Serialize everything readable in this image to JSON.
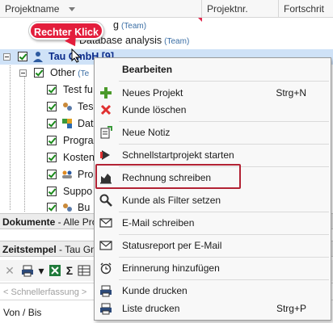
{
  "grid": {
    "columns": [
      "Projektname",
      "Projektnr.",
      "Fortschrit"
    ]
  },
  "tree": {
    "rows": [
      {
        "label": "g",
        "team": "(Team)"
      },
      {
        "label": "Database analysis",
        "team": "(Team)"
      },
      {
        "label": "Tau GmbH [9]",
        "team": ""
      },
      {
        "label": "Other",
        "team": "(Te"
      },
      {
        "label": "Test fu",
        "team": ""
      },
      {
        "label": "Tes",
        "team": ""
      },
      {
        "label": "Dat",
        "team": ""
      },
      {
        "label": "Progra",
        "team": ""
      },
      {
        "label": "Kosten",
        "team": ""
      },
      {
        "label": "Pro",
        "team": ""
      },
      {
        "label": "Suppo",
        "team": ""
      },
      {
        "label": "Bu",
        "team": ""
      }
    ]
  },
  "callout": {
    "text": "Rechter Klick",
    "color": "#e31e3c"
  },
  "panels": {
    "documents": {
      "title": "Dokumente",
      "rest": " - Alle Pro"
    },
    "timestamps": {
      "title": "Zeitstempel",
      "rest": " - Tau Gm"
    },
    "quick_entry_placeholder": "< Schnellerfassung >",
    "von_bis": "Von / Bis"
  },
  "context_menu": {
    "items": [
      {
        "label": "Bearbeiten",
        "shortcut": "",
        "icon": "no-icon"
      },
      {
        "label": "Neues Projekt",
        "shortcut": "Strg+N",
        "icon": "plus-icon"
      },
      {
        "label": "Kunde löschen",
        "shortcut": "",
        "icon": "delete-x-icon"
      },
      {
        "label": "Neue Notiz",
        "shortcut": "",
        "icon": "note-icon"
      },
      {
        "label": "Schnellstartprojekt starten",
        "shortcut": "",
        "icon": "quickstart-icon"
      },
      {
        "label": "Rechnung schreiben",
        "shortcut": "",
        "icon": "invoice-icon"
      },
      {
        "label": "Kunde als Filter setzen",
        "shortcut": "",
        "icon": "magnifier-icon"
      },
      {
        "label": "E-Mail schreiben",
        "shortcut": "",
        "icon": "envelope-icon"
      },
      {
        "label": "Statusreport per E-Mail",
        "shortcut": "",
        "icon": "envelope-icon"
      },
      {
        "label": "Erinnerung hinzufügen",
        "shortcut": "",
        "icon": "alarm-clock-icon"
      },
      {
        "label": "Kunde drucken",
        "shortcut": "",
        "icon": "printer-icon"
      },
      {
        "label": "Liste drucken",
        "shortcut": "Strg+P",
        "icon": "printer-icon"
      }
    ],
    "highlight_color": "#b22234"
  },
  "colors": {
    "selected_row": "#cfe2f7",
    "team_text": "#3a6ea5",
    "check_green": "#1a8a1a"
  }
}
